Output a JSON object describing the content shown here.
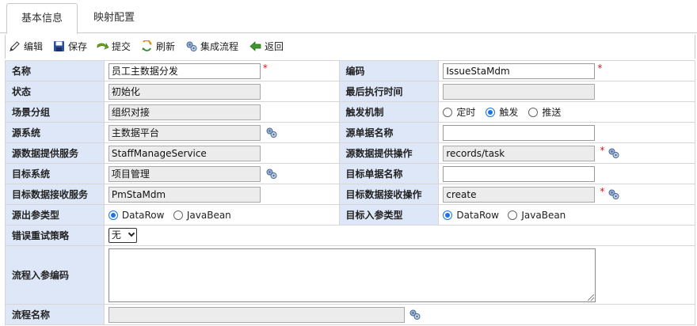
{
  "tabs": [
    {
      "label": "基本信息",
      "active": true
    },
    {
      "label": "映射配置",
      "active": false
    }
  ],
  "toolbar": {
    "edit": "编辑",
    "save": "保存",
    "submit": "提交",
    "refresh": "刷新",
    "integrate": "集成流程",
    "back": "返回"
  },
  "form": {
    "name": {
      "label": "名称",
      "value": "员工主数据分发"
    },
    "code": {
      "label": "编码",
      "value": "IssueStaMdm"
    },
    "status": {
      "label": "状态",
      "value": "初始化"
    },
    "last_exec_time": {
      "label": "最后执行时间",
      "value": ""
    },
    "scene_group": {
      "label": "场景分组",
      "value": "组织对接"
    },
    "trigger": {
      "label": "触发机制",
      "options": [
        "定时",
        "触发",
        "推送"
      ],
      "selected": "触发"
    },
    "source_system": {
      "label": "源系统",
      "value": "主数据平台"
    },
    "source_doc_name": {
      "label": "源单据名称",
      "value": ""
    },
    "source_service": {
      "label": "源数据提供服务",
      "value": "StaffManageService"
    },
    "source_operation": {
      "label": "源数据提供操作",
      "value": "records/task"
    },
    "target_system": {
      "label": "目标系统",
      "value": "项目管理"
    },
    "target_doc_name": {
      "label": "目标单据名称",
      "value": ""
    },
    "target_service": {
      "label": "目标数据接收服务",
      "value": "PmStaMdm"
    },
    "target_operation": {
      "label": "目标数据接收操作",
      "value": "create"
    },
    "source_out_type": {
      "label": "源出参类型",
      "options": [
        "DataRow",
        "JavaBean"
      ],
      "selected": "DataRow"
    },
    "target_in_type": {
      "label": "目标入参类型",
      "options": [
        "DataRow",
        "JavaBean"
      ],
      "selected": "DataRow"
    },
    "retry_strategy": {
      "label": "错误重试策略",
      "value": "无"
    },
    "flow_input_code": {
      "label": "流程入参编码",
      "value": ""
    },
    "flow_name": {
      "label": "流程名称",
      "value": ""
    }
  },
  "required_mark": "*",
  "colors": {
    "label_bg": "#dde7f7",
    "readonly_bg": "#ececec",
    "required": "#d21818",
    "radio_accent": "#1a73e8"
  }
}
